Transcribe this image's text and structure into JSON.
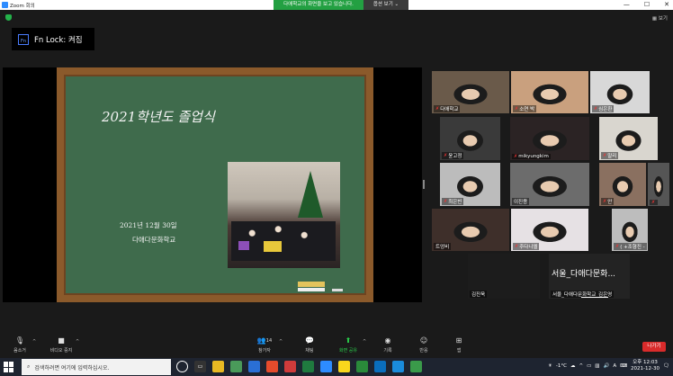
{
  "window": {
    "title": "Zoom 회의",
    "share_banner": "다애학교의 화면을 보고 있습니다.",
    "view_options": "옵션 보기 ⌄",
    "view_toggle": "▦ 보기",
    "min_btn": "—",
    "max_btn": "☐",
    "close_btn": "✕"
  },
  "overlay": {
    "fn_lock": "Fn Lock: 켜짐",
    "fn_icon": "Fn"
  },
  "slide": {
    "title": "2021학년도 졸업식",
    "date": "2021년 12월 30일",
    "school": "다애다문화학교"
  },
  "gallery": {
    "tiles": [
      {
        "name": "다애학교",
        "muted": true
      },
      {
        "name": "소연 박",
        "muted": true
      },
      {
        "name": "심은환",
        "muted": true
      },
      {
        "name": "윤고정",
        "muted": true
      },
      {
        "name": "mikyungkim",
        "muted": true
      },
      {
        "name": "말리",
        "muted": true
      },
      {
        "name": "최은빈",
        "muted": true
      },
      {
        "name": "이진용",
        "muted": false
      },
      {
        "name": "안",
        "muted": true
      },
      {
        "name": "",
        "muted": true
      },
      {
        "name": "트엉비",
        "muted": false
      },
      {
        "name": "주다니엘",
        "muted": true
      },
      {
        "name": "(   +조형진 -",
        "muted": true
      },
      {
        "name": "김진욱",
        "muted": false
      },
      {
        "name": "서울_다애다문화학교_김은영",
        "muted": false
      }
    ],
    "big_name": "서울_다애다문화..."
  },
  "controls": {
    "mute": "음소거",
    "video": "비디오 중지",
    "participants": "참가자",
    "participants_count": "14",
    "chat": "채팅",
    "share": "화면 공유",
    "record": "기록",
    "reactions": "반응",
    "apps": "앱",
    "leave": "나가기"
  },
  "taskbar": {
    "search_placeholder": "검색하려면 여기에 입력하십시오.",
    "weather": "-1°C",
    "ime": "A",
    "time": "오후 12:03",
    "date": "2021-12-30"
  }
}
